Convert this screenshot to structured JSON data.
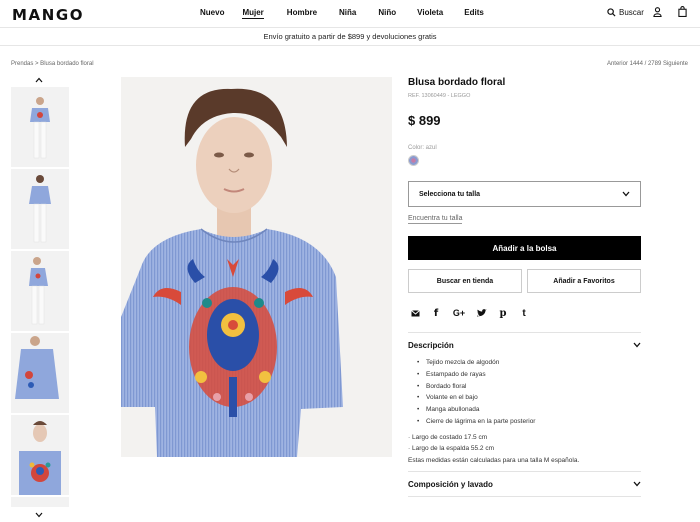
{
  "header": {
    "logo": "MANGO",
    "nav": [
      "Nuevo",
      "Mujer",
      "Hombre",
      "Niña",
      "Niño",
      "Violeta",
      "Edits"
    ],
    "active_nav": "Mujer",
    "search_label": "Buscar",
    "user_icon": "user-icon",
    "bag_icon": "bag-icon"
  },
  "promo": "Envío gratuito a partir de $899 y devoluciones gratis",
  "breadcrumb": "Prendas > Blusa bordado floral",
  "pager": "Anterior 1444 / 2789 Siguiente",
  "product": {
    "title": "Blusa bordado floral",
    "ref": "REF. 13060449 - LEGGO",
    "price": "$ 899",
    "color_label": "Color: azul",
    "size_select": "Selecciona tu talla",
    "size_guide": "Encuentra tu talla",
    "add_to_bag": "Añadir a la bolsa",
    "find_in_store": "Buscar en tienda",
    "add_to_favorites": "Añadir a Favoritos",
    "share_icons": [
      "mail-icon",
      "facebook-icon",
      "google-plus-icon",
      "twitter-icon",
      "pinterest-icon",
      "tumblr-icon"
    ],
    "description_title": "Descripción",
    "description_items": [
      "Tejido mezcla de algodón",
      "Estampado de rayas",
      "Bordado floral",
      "Volante en el bajo",
      "Manga abullonada",
      "Cierre de lágrima en la parte posterior"
    ],
    "measures": [
      "· Largo de costado 17.5 cm",
      "· Largo de la espalda 55.2 cm",
      "Estas medidas están calculadas para una talla M española."
    ],
    "composition_title": "Composición y lavado"
  },
  "colors": {
    "blouse": "#8fa7dc",
    "accent_black": "#000000"
  }
}
